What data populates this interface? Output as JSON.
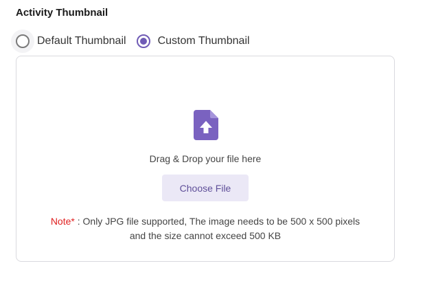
{
  "section": {
    "title": "Activity Thumbnail"
  },
  "thumbnail_options": [
    {
      "label": "Default Thumbnail",
      "checked": false
    },
    {
      "label": "Custom Thumbnail",
      "checked": true
    }
  ],
  "dropzone": {
    "icon": "file-upload-icon",
    "drag_text": "Drag & Drop your file here",
    "choose_button": "Choose File",
    "note_prefix": "Note*",
    "note_line1": " : Only JPG file supported, The image needs to be 500 x 500 pixels",
    "note_line2": "and the size cannot exceed 500 KB"
  },
  "colors": {
    "accent": "#6f5bb5",
    "button_bg": "#ebe8f6",
    "note_prefix": "#e02020",
    "border": "#d9d9de"
  }
}
